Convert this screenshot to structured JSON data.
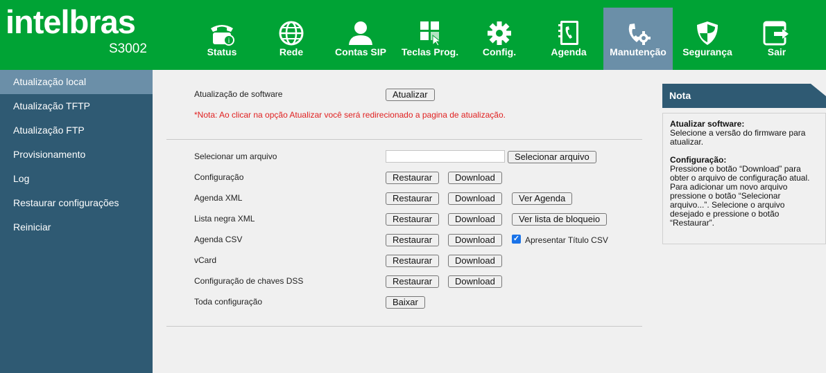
{
  "brand": {
    "logo": "intelbras",
    "model": "S3002"
  },
  "nav": [
    {
      "id": "status",
      "label": "Status",
      "icon": "phone-status-icon"
    },
    {
      "id": "rede",
      "label": "Rede",
      "icon": "globe-icon"
    },
    {
      "id": "contas",
      "label": "Contas SIP",
      "icon": "user-icon"
    },
    {
      "id": "teclas",
      "label": "Teclas Prog.",
      "icon": "grid-keys-icon"
    },
    {
      "id": "config",
      "label": "Config.",
      "icon": "gear-icon"
    },
    {
      "id": "agenda",
      "label": "Agenda",
      "icon": "phonebook-icon"
    },
    {
      "id": "manutencao",
      "label": "Manutenção",
      "icon": "phone-gear-icon",
      "active": true
    },
    {
      "id": "seguranca",
      "label": "Segurança",
      "icon": "shield-icon"
    },
    {
      "id": "sair",
      "label": "Sair",
      "icon": "exit-icon"
    }
  ],
  "sidebar": {
    "items": [
      {
        "label": "Atualização local",
        "active": true
      },
      {
        "label": "Atualização TFTP"
      },
      {
        "label": "Atualização FTP"
      },
      {
        "label": "Provisionamento"
      },
      {
        "label": "Log"
      },
      {
        "label": "Restaurar configurações"
      },
      {
        "label": "Reiniciar"
      }
    ]
  },
  "main": {
    "software": {
      "label": "Atualização de software",
      "button": "Atualizar"
    },
    "note_red": "*Nota: Ao clicar na opção Atualizar você será redirecionado a pagina de atualização.",
    "select_file": {
      "label": "Selecionar um arquivo",
      "button": "Selecionar arquivo",
      "value": ""
    },
    "rows": [
      {
        "label": "Configuração",
        "restore": "Restaurar",
        "download": "Download"
      },
      {
        "label": "Agenda XML",
        "restore": "Restaurar",
        "download": "Download",
        "extra": "Ver Agenda"
      },
      {
        "label": "Lista negra XML",
        "restore": "Restaurar",
        "download": "Download",
        "extra": "Ver lista de bloqueio"
      },
      {
        "label": "Agenda CSV",
        "restore": "Restaurar",
        "download": "Download",
        "checkbox": "Apresentar Título CSV",
        "checked": true
      },
      {
        "label": "vCard",
        "restore": "Restaurar",
        "download": "Download"
      },
      {
        "label": "Configuração de chaves DSS",
        "restore": "Restaurar",
        "download": "Download"
      }
    ],
    "all_config": {
      "label": "Toda configuração",
      "button": "Baixar"
    }
  },
  "note": {
    "title": "Nota",
    "software_title": "Atualizar software:",
    "software_text": "Selecione a versão do firmware para atualizar.",
    "config_title": "Configuração:",
    "config_text": "Pressione o botão “Download” para obter o arquivo de configuração atual. Para adicionar um novo arquivo pressione o botão “Selecionar arquivo...”. Selecione o arquivo desejado e pressione o botão “Restaurar”."
  },
  "colors": {
    "header": "#00a335",
    "sidebar": "#2f5a73",
    "active": "#6b8fa8",
    "note_red": "#e02020"
  }
}
